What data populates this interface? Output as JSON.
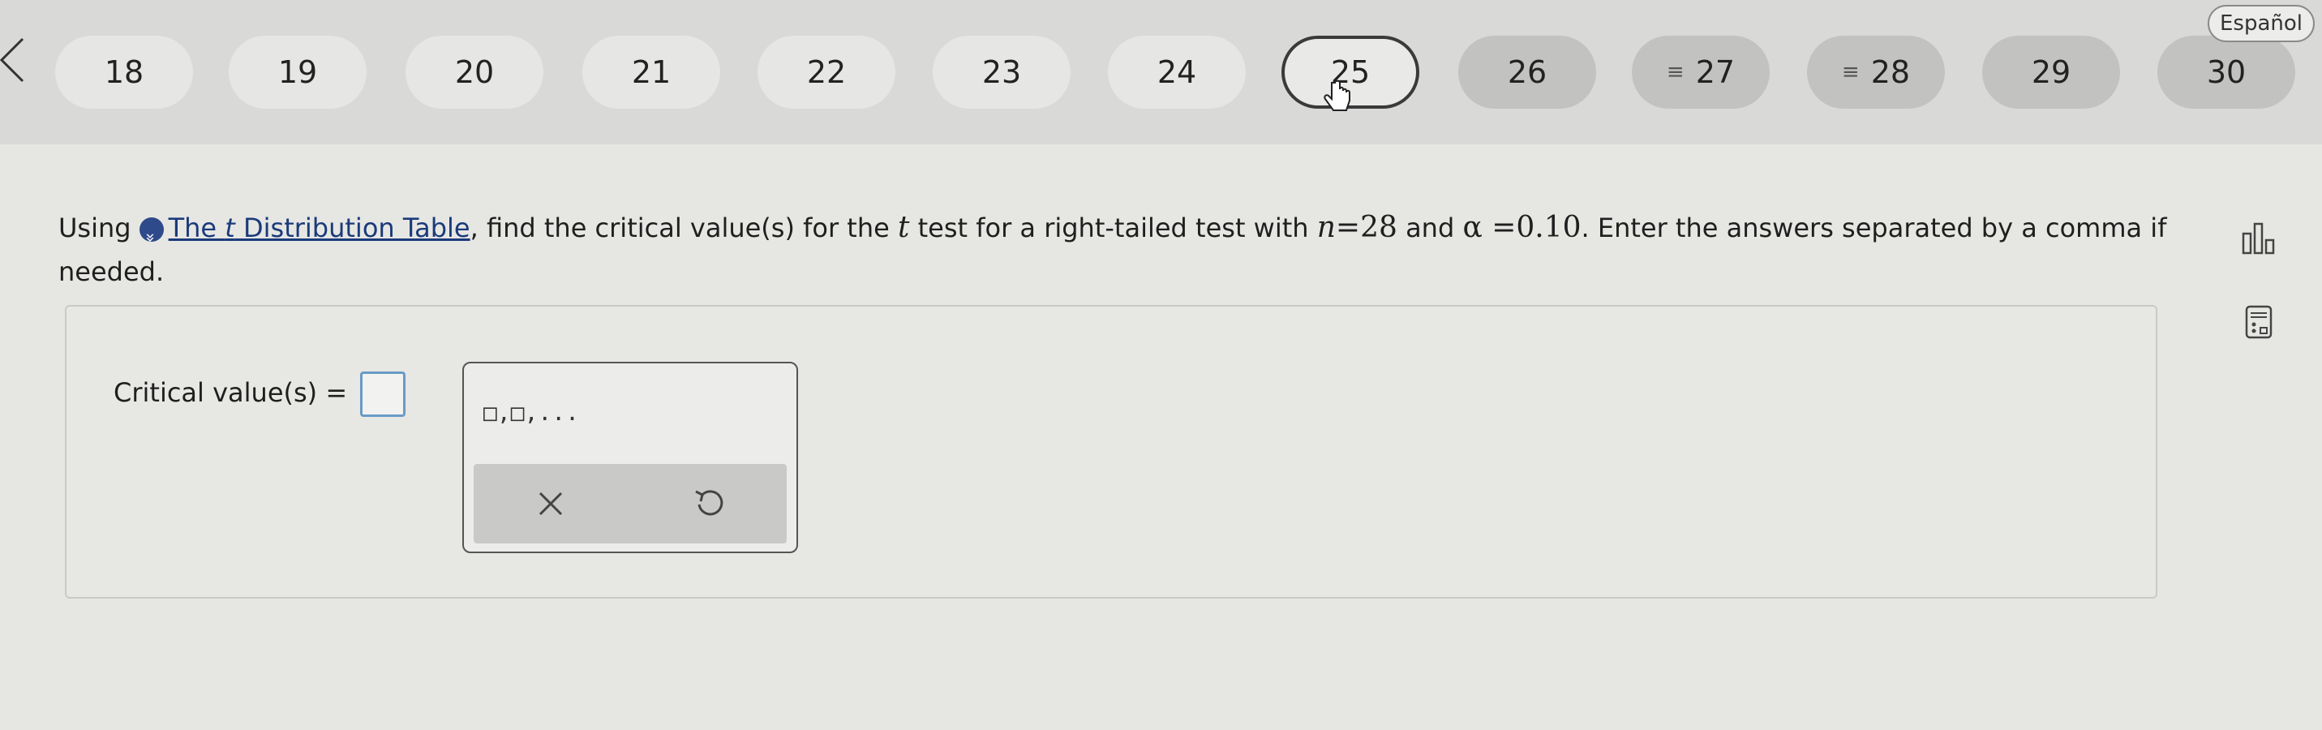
{
  "nav": {
    "back_icon": "chevron-left-icon",
    "questions": [
      {
        "label": "18",
        "state": "default"
      },
      {
        "label": "19",
        "state": "default"
      },
      {
        "label": "20",
        "state": "default"
      },
      {
        "label": "21",
        "state": "default"
      },
      {
        "label": "22",
        "state": "default"
      },
      {
        "label": "23",
        "state": "default"
      },
      {
        "label": "24",
        "state": "default"
      },
      {
        "label": "25",
        "state": "current"
      },
      {
        "label": "26",
        "state": "answered"
      },
      {
        "label": "27",
        "state": "partial"
      },
      {
        "label": "28",
        "state": "partial"
      },
      {
        "label": "29",
        "state": "answered"
      },
      {
        "label": "30",
        "state": "answered"
      }
    ],
    "language_button": "Español"
  },
  "question": {
    "prefix": "Using",
    "link_text_a": "The ",
    "link_text_t": "t",
    "link_text_b": " Distribution Table",
    "part1": ", find the critical value(s) for the ",
    "t_symbol": "t",
    "part2": " test for a right-tailed test with ",
    "n_symbol": "n",
    "n_value": "=28",
    "and": " and ",
    "alpha_symbol": "α",
    "alpha_value": " =0.10",
    "part3": ". Enter the answers separated by a comma if needed."
  },
  "answer": {
    "label": "Critical value(s) =",
    "input_value": "",
    "template_label": "□,□,..."
  },
  "colors": {
    "accent": "#2e4a8a",
    "input_border": "#6a9bc6",
    "current_border": "#3a3a3a"
  }
}
